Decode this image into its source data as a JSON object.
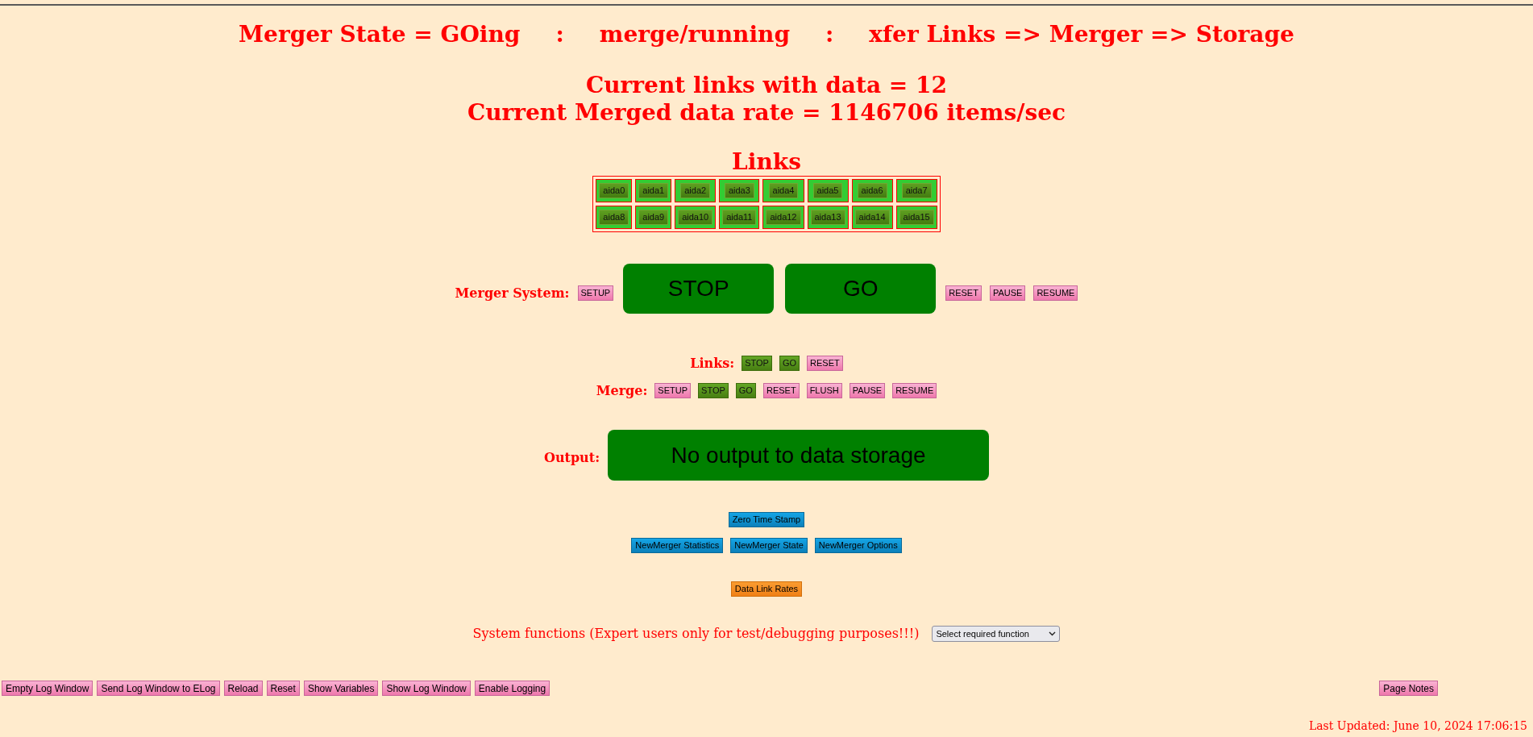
{
  "title": [
    "Merger State = GOing",
    ":",
    "merge/running",
    ":",
    "xfer Links => Merger => Storage"
  ],
  "status_lines": [
    "Current links with data = 12",
    "Current Merged data rate = 1146706 items/sec"
  ],
  "links": {
    "title": "Links",
    "rows": [
      [
        "aida0",
        "aida1",
        "aida2",
        "aida3",
        "aida4",
        "aida5",
        "aida6",
        "aida7"
      ],
      [
        "aida8",
        "aida9",
        "aida10",
        "aida11",
        "aida12",
        "aida13",
        "aida14",
        "aida15"
      ]
    ]
  },
  "merger_system": {
    "label": "Merger System:",
    "buttons": [
      {
        "label": "SETUP",
        "kind": "action"
      },
      {
        "label": "STOP",
        "kind": "large"
      },
      {
        "label": "GO",
        "kind": "large"
      },
      {
        "label": "RESET",
        "kind": "action"
      },
      {
        "label": "PAUSE",
        "kind": "action"
      },
      {
        "label": "RESUME",
        "kind": "action"
      }
    ]
  },
  "links_controls": {
    "label": "Links:",
    "buttons": [
      {
        "label": "STOP",
        "kind": "active"
      },
      {
        "label": "GO",
        "kind": "active"
      },
      {
        "label": "RESET",
        "kind": "action"
      }
    ]
  },
  "merge_controls": {
    "label": "Merge:",
    "buttons": [
      {
        "label": "SETUP",
        "kind": "action"
      },
      {
        "label": "STOP",
        "kind": "active"
      },
      {
        "label": "GO",
        "kind": "active"
      },
      {
        "label": "RESET",
        "kind": "action"
      },
      {
        "label": "FLUSH",
        "kind": "action"
      },
      {
        "label": "PAUSE",
        "kind": "action"
      },
      {
        "label": "RESUME",
        "kind": "action"
      }
    ]
  },
  "output": {
    "label": "Output:",
    "button": {
      "label": "No output to data storage",
      "kind": "wide"
    }
  },
  "tool_rows": [
    [
      {
        "label": "Zero Time Stamp",
        "kind": "info"
      }
    ],
    [
      {
        "label": "NewMerger Statistics",
        "kind": "info"
      },
      {
        "label": "NewMerger State",
        "kind": "info"
      },
      {
        "label": "NewMerger Options",
        "kind": "info"
      }
    ],
    [
      {
        "label": "Data Link Rates",
        "kind": "highlight"
      }
    ]
  ],
  "system_functions": {
    "text": "System functions (Expert users only for test/debugging purposes!!!)",
    "select": {
      "value": "Select required function"
    }
  },
  "footer": {
    "buttons": [
      "Empty Log Window",
      "Send Log Window to ELog",
      "Reload",
      "Reset",
      "Show Variables",
      "Show Log Window",
      "Enable Logging"
    ],
    "page_notes": "Page Notes",
    "last_updated": "Last Updated: June 10, 2024 17:06:15"
  }
}
